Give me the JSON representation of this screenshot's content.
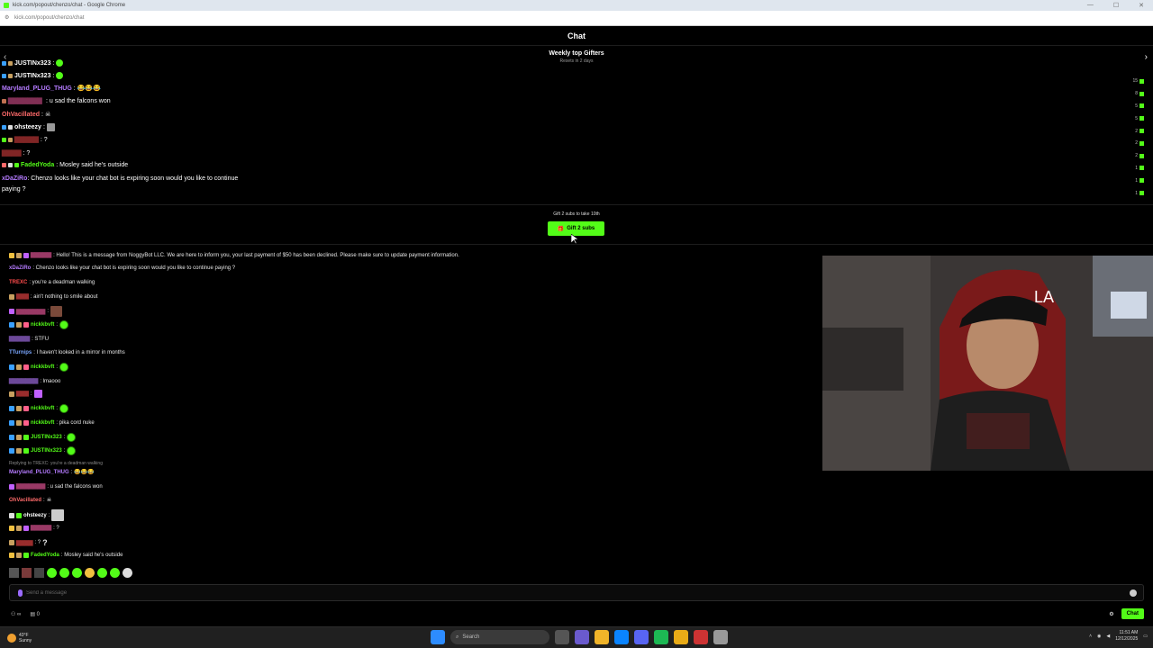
{
  "browser": {
    "window_title": "kick.com/popout/chenzo/chat - Google Chrome",
    "url": "kick.com/popout/chenzo/chat",
    "window_buttons": [
      "—",
      "☐",
      "✕"
    ]
  },
  "chat": {
    "header_title": "Chat",
    "top_gifters": {
      "title": "Weekly top Gifters",
      "subtitle": "Resets in 2 days",
      "counts": [
        "15",
        "8",
        "5",
        "5",
        "2",
        "2",
        "2",
        "1",
        "1",
        "1"
      ]
    },
    "overlay_lines": [
      {
        "user": "JUSTINx323",
        "text": ":",
        "user_color": "#ffffff",
        "emote": "green"
      },
      {
        "user": "JUSTINx323",
        "text": ":",
        "user_color": "#ffffff",
        "emote": "green"
      },
      {
        "user": "Maryland_PLUG_THUG",
        "text": ": 😂😂😂",
        "user_color": "#b57bff",
        "emote": ""
      },
      {
        "user": "",
        "text": ": u sad the falcons won",
        "user_color": "#ff5fa8",
        "emote": ""
      },
      {
        "user": "OhVacillated",
        "text": ":",
        "user_color": "#ff6a6a",
        "emote": "skull"
      },
      {
        "user": "ohsteezy",
        "text": ":",
        "user_color": "#ffffff",
        "emote": "box"
      },
      {
        "user": "",
        "text": ": ?",
        "user_color": "#ff4b4b",
        "emote": ""
      },
      {
        "user": "",
        "text": ": ?",
        "user_color": "#ff4b4b",
        "emote": ""
      },
      {
        "user": "FadedYoda",
        "text": ": Mosley said he's outside",
        "user_color": "#53fc18",
        "emote": ""
      }
    ],
    "overlay_wrap": {
      "user": "xDaZiRo",
      "text": ": Chenzo looks like your chat bot is expiring soon would you like to continue paying ?"
    },
    "gift": {
      "note": "Gift 2 subs to take 10th",
      "button_label": "Gift 2 subs"
    },
    "messages": [
      {
        "user": "",
        "text": ": Hello! This is a message from NoggyBot LLC. We are here to inform you, your last payment of $50 has been declined. Please make sure to update payment information.",
        "user_color": "#ff5fa8",
        "kind": "text"
      },
      {
        "user": "xDaZiRo",
        "text": ": Chenzo looks like your chat bot is expiring soon would you like to continue paying ?",
        "user_color": "#b57bff",
        "kind": "text"
      },
      {
        "user": "TREXC",
        "text": ": you're a deadman walking",
        "user_color": "#ff4b4b",
        "kind": "text"
      },
      {
        "user": "",
        "text": ": ain't nothing to smile about",
        "user_color": "#ff4b4b",
        "kind": "text"
      },
      {
        "user": "",
        "text": ":",
        "user_color": "#ff5fa8",
        "kind": "image"
      },
      {
        "user": "nickkbvft",
        "text": ":",
        "user_color": "#53fc18",
        "kind": "emote"
      },
      {
        "user": "",
        "text": ": STFU",
        "user_color": "#b57bff",
        "kind": "text"
      },
      {
        "user": "TTurnips",
        "text": ": I haven't looked in a mirror in months",
        "user_color": "#7aa7ff",
        "kind": "text"
      },
      {
        "user": "nickkbvft",
        "text": ":",
        "user_color": "#53fc18",
        "kind": "emote"
      },
      {
        "user": "",
        "text": ": lmaooo",
        "user_color": "#b57bff",
        "kind": "text"
      },
      {
        "user": "",
        "text": ":",
        "user_color": "#ff4b4b",
        "kind": "image"
      },
      {
        "user": "nickkbvft",
        "text": ":",
        "user_color": "#53fc18",
        "kind": "emote"
      },
      {
        "user": "nickkbvft",
        "text": ": pika cord nuke",
        "user_color": "#53fc18",
        "kind": "text"
      },
      {
        "user": "JUSTINx323",
        "text": ":",
        "user_color": "#53fc18",
        "kind": "emote"
      },
      {
        "user": "JUSTINx323",
        "text": ":",
        "user_color": "#53fc18",
        "kind": "emote"
      },
      {
        "user": "Maryland_PLUG_THUG",
        "text": ": 😂😂😂",
        "user_color": "#b57bff",
        "kind": "text",
        "reply": "Replying to TREXC: you're a deadman walking"
      },
      {
        "user": "",
        "text": ": u sad the falcons won",
        "user_color": "#ff5fa8",
        "kind": "text"
      },
      {
        "user": "OhVacillated",
        "text": ":",
        "user_color": "#ff6a6a",
        "kind": "skull"
      },
      {
        "user": "ohsteezy",
        "text": ":",
        "user_color": "#ffffff",
        "kind": "box"
      },
      {
        "user": "",
        "text": ": ?",
        "user_color": "#ff5fa8",
        "kind": "text"
      },
      {
        "user": "",
        "text": ": ?",
        "user_color": "#ff4b4b",
        "kind": "text"
      },
      {
        "user": "FadedYoda",
        "text": ": Mosley said he's outside",
        "user_color": "#53fc18",
        "kind": "text"
      }
    ],
    "composer": {
      "placeholder": "Send a message"
    },
    "footer": {
      "viewers_icon": "people-icon",
      "points": "0",
      "send_label": "Chat"
    }
  },
  "taskbar": {
    "weather_temp": "43°F",
    "weather_desc": "Sunny",
    "search_label": "Search",
    "time": "11:51 AM",
    "date": "12/12/2025"
  },
  "colors": {
    "kick_green": "#53fc18",
    "background": "#000000"
  }
}
